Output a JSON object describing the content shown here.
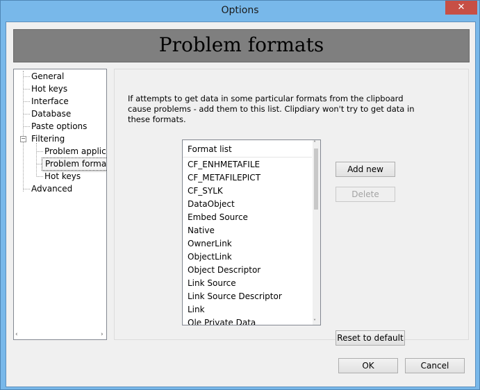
{
  "window": {
    "title": "Options",
    "close_label": "✕"
  },
  "banner": {
    "title": "Problem formats"
  },
  "tree": {
    "items": [
      {
        "label": "General"
      },
      {
        "label": "Hot keys"
      },
      {
        "label": "Interface"
      },
      {
        "label": "Database"
      },
      {
        "label": "Paste options"
      },
      {
        "label": "Filtering",
        "expander": "−"
      },
      {
        "label": "Problem applicat"
      },
      {
        "label": "Problem formats",
        "selected": true
      },
      {
        "label": "Hot keys"
      },
      {
        "label": "Advanced"
      }
    ],
    "scroll_left": "‹",
    "scroll_right": "›"
  },
  "panel": {
    "description": "If attempts to get data in some particular formats from the clipboard cause problems - add them to this list. Clipdiary won't try to get data in these formats.",
    "list": {
      "header": "Format list",
      "items": [
        "CF_ENHMETAFILE",
        "CF_METAFILEPICT",
        "CF_SYLK",
        "DataObject",
        "Embed Source",
        "Native",
        "OwnerLink",
        "ObjectLink",
        "Object Descriptor",
        "Link Source",
        "Link Source Descriptor",
        "Link",
        "Ole Private Data"
      ],
      "scroll_up": "˄",
      "scroll_down": "˅"
    },
    "add_new_label": "Add new",
    "delete_label": "Delete",
    "reset_label": "Reset to default"
  },
  "footer": {
    "ok_label": "OK",
    "cancel_label": "Cancel"
  }
}
